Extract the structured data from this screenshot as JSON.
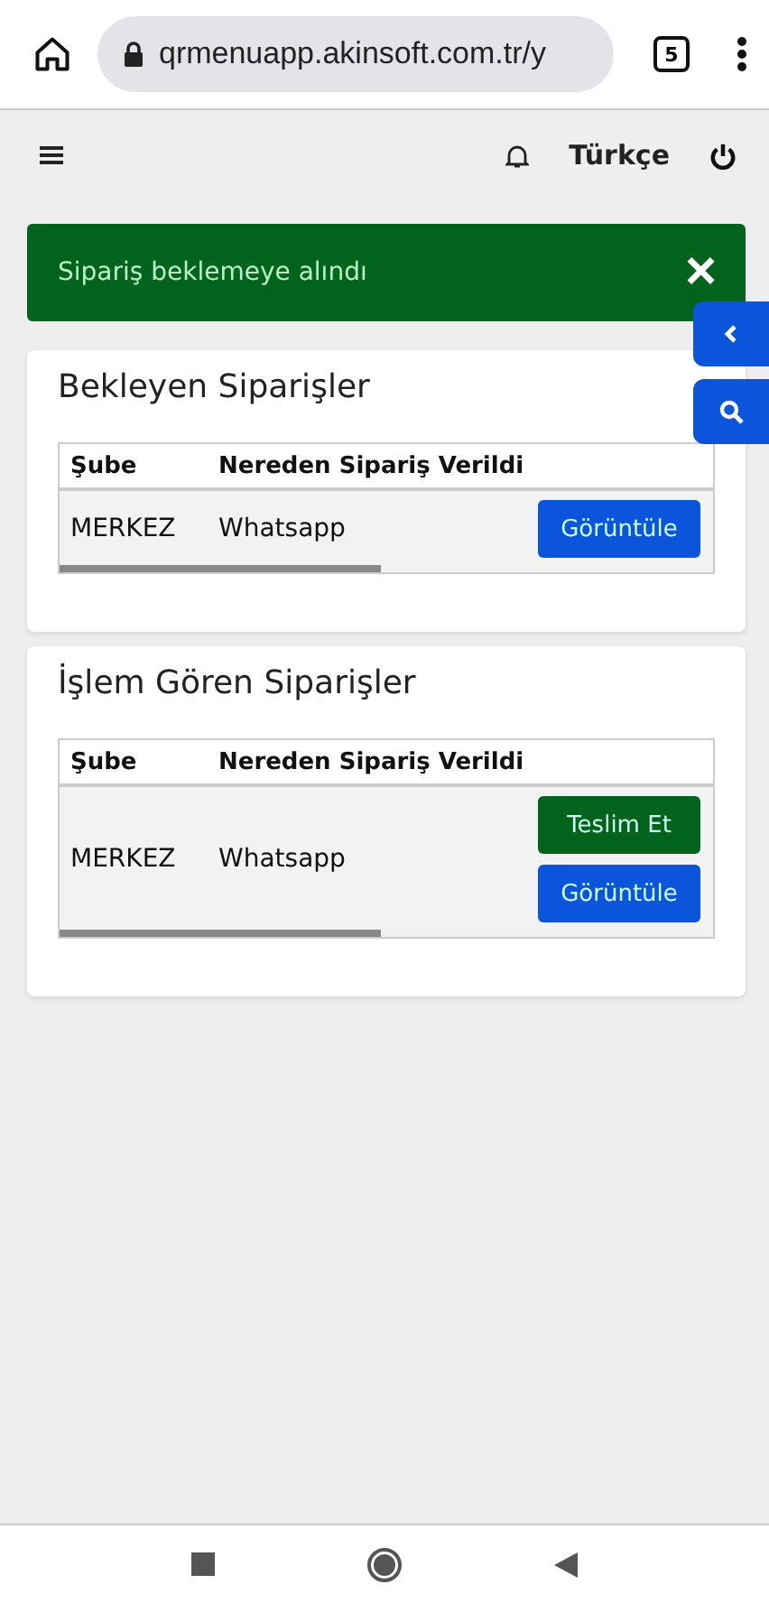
{
  "browser": {
    "url": "qrmenuapp.akinsoft.com.tr/y",
    "tab_count": "5"
  },
  "header": {
    "language": "Türkçe"
  },
  "alert": {
    "message": "Sipariş beklemeye alındı",
    "close": "×"
  },
  "sections": [
    {
      "title": "Bekleyen Siparişler",
      "columns": [
        "Şube",
        "Nereden Sipariş Verildi"
      ],
      "rows": [
        {
          "cells": [
            "MERKEZ",
            "Whatsapp"
          ],
          "actions": [
            {
              "kind": "view",
              "label": "Görüntüle"
            }
          ]
        }
      ]
    },
    {
      "title": "İşlem Gören Siparişler",
      "columns": [
        "Şube",
        "Nereden Sipariş Verildi"
      ],
      "rows": [
        {
          "cells": [
            "MERKEZ",
            "Whatsapp"
          ],
          "actions": [
            {
              "kind": "deliver",
              "label": "Teslim Et"
            },
            {
              "kind": "view",
              "label": "Görüntüle"
            }
          ]
        }
      ]
    }
  ]
}
